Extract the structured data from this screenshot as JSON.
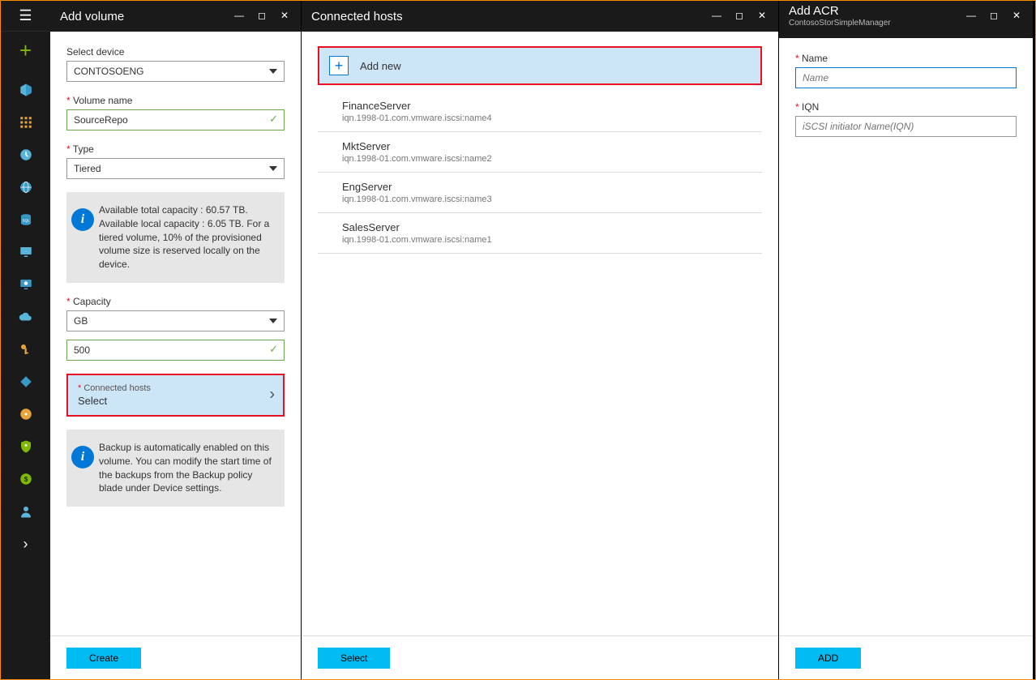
{
  "blade1": {
    "title": "Add volume",
    "select_device_label": "Select device",
    "select_device_value": "CONTOSOENG",
    "volume_name_label": "Volume name",
    "volume_name_value": "SourceRepo",
    "type_label": "Type",
    "type_value": "Tiered",
    "capacity_info": "Available total capacity : 60.57 TB. Available local capacity : 6.05 TB. For a tiered volume, 10% of the provisioned volume size is reserved locally on the device.",
    "capacity_label": "Capacity",
    "capacity_unit": "GB",
    "capacity_value": "500",
    "connected_hosts_label": "Connected hosts",
    "connected_hosts_value": "Select",
    "backup_info": "Backup is automatically enabled on this volume. You can modify the start time of the backups from the Backup policy blade under Device settings.",
    "create_btn": "Create"
  },
  "blade2": {
    "title": "Connected hosts",
    "add_new": "Add new",
    "hosts": [
      {
        "name": "FinanceServer",
        "iqn": "iqn.1998-01.com.vmware.iscsi:name4"
      },
      {
        "name": "MktServer",
        "iqn": "iqn.1998-01.com.vmware.iscsi:name2"
      },
      {
        "name": "EngServer",
        "iqn": "iqn.1998-01.com.vmware.iscsi:name3"
      },
      {
        "name": "SalesServer",
        "iqn": "iqn.1998-01.com.vmware.iscsi:name1"
      }
    ],
    "select_btn": "Select"
  },
  "blade3": {
    "title": "Add ACR",
    "subtitle": "ContosoStorSimpleManager",
    "name_label": "Name",
    "name_placeholder": "Name",
    "iqn_label": "IQN",
    "iqn_placeholder": "iSCSI initiator Name(IQN)",
    "add_btn": "ADD"
  }
}
